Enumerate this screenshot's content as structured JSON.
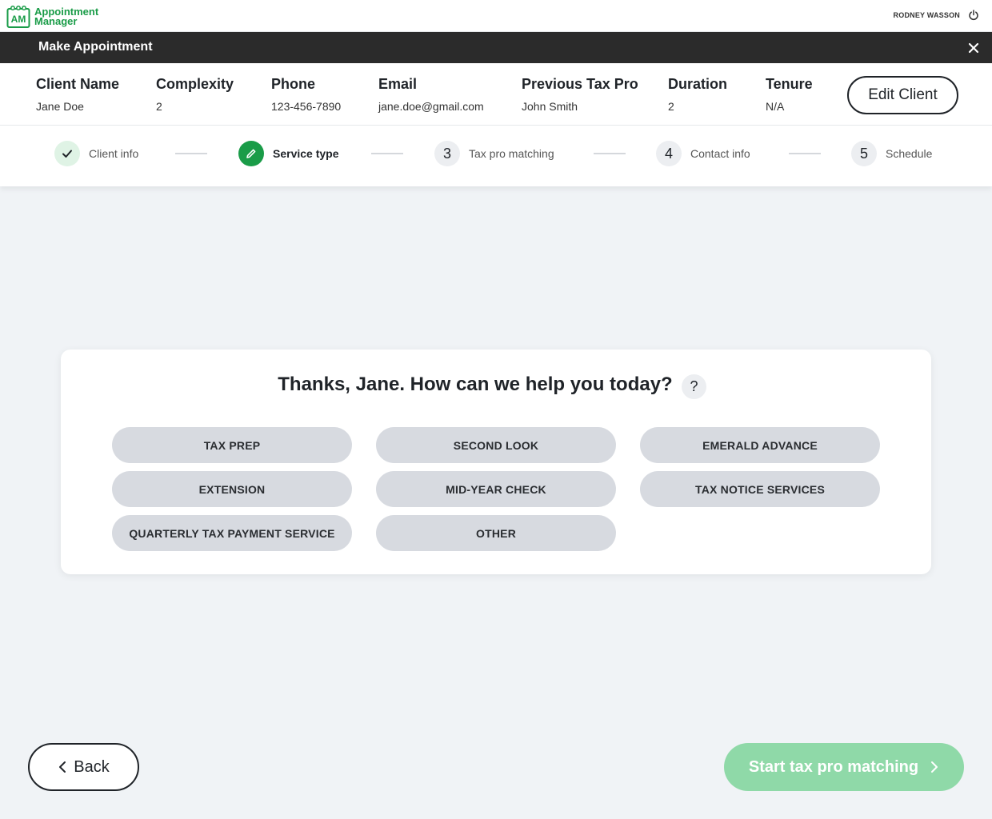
{
  "app": {
    "logo_abbr": "AM",
    "logo_line1": "Appointment",
    "logo_line2": "Manager",
    "user_name": "RODNEY WASSON",
    "brand_color": "#1a9c48"
  },
  "modal": {
    "title": "Make Appointment"
  },
  "client": {
    "fields": [
      {
        "label": "Client Name",
        "value": "Jane Doe"
      },
      {
        "label": "Complexity",
        "value": "2"
      },
      {
        "label": "Phone",
        "value": "123-456-7890"
      },
      {
        "label": "Email",
        "value": "jane.doe@gmail.com"
      },
      {
        "label": "Previous Tax Pro",
        "value": "John Smith"
      },
      {
        "label": "Duration",
        "value": "2"
      },
      {
        "label": "Tenure",
        "value": "N/A"
      }
    ],
    "edit_label": "Edit Client"
  },
  "steps": [
    {
      "number": "1",
      "label": "Client info",
      "state": "done"
    },
    {
      "number": "2",
      "label": "Service type",
      "state": "active"
    },
    {
      "number": "3",
      "label": "Tax pro matching",
      "state": "pending"
    },
    {
      "number": "4",
      "label": "Contact info",
      "state": "pending"
    },
    {
      "number": "5",
      "label": "Schedule",
      "state": "pending"
    }
  ],
  "card": {
    "title": "Thanks, Jane. How can we help you today?",
    "help_label": "?",
    "services": [
      "TAX PREP",
      "SECOND LOOK",
      "EMERALD ADVANCE",
      "EXTENSION",
      "MID-YEAR CHECK",
      "TAX NOTICE SERVICES",
      "QUARTERLY TAX PAYMENT SERVICE",
      "OTHER"
    ]
  },
  "footer": {
    "back_label": "Back",
    "next_label": "Start tax pro matching"
  }
}
